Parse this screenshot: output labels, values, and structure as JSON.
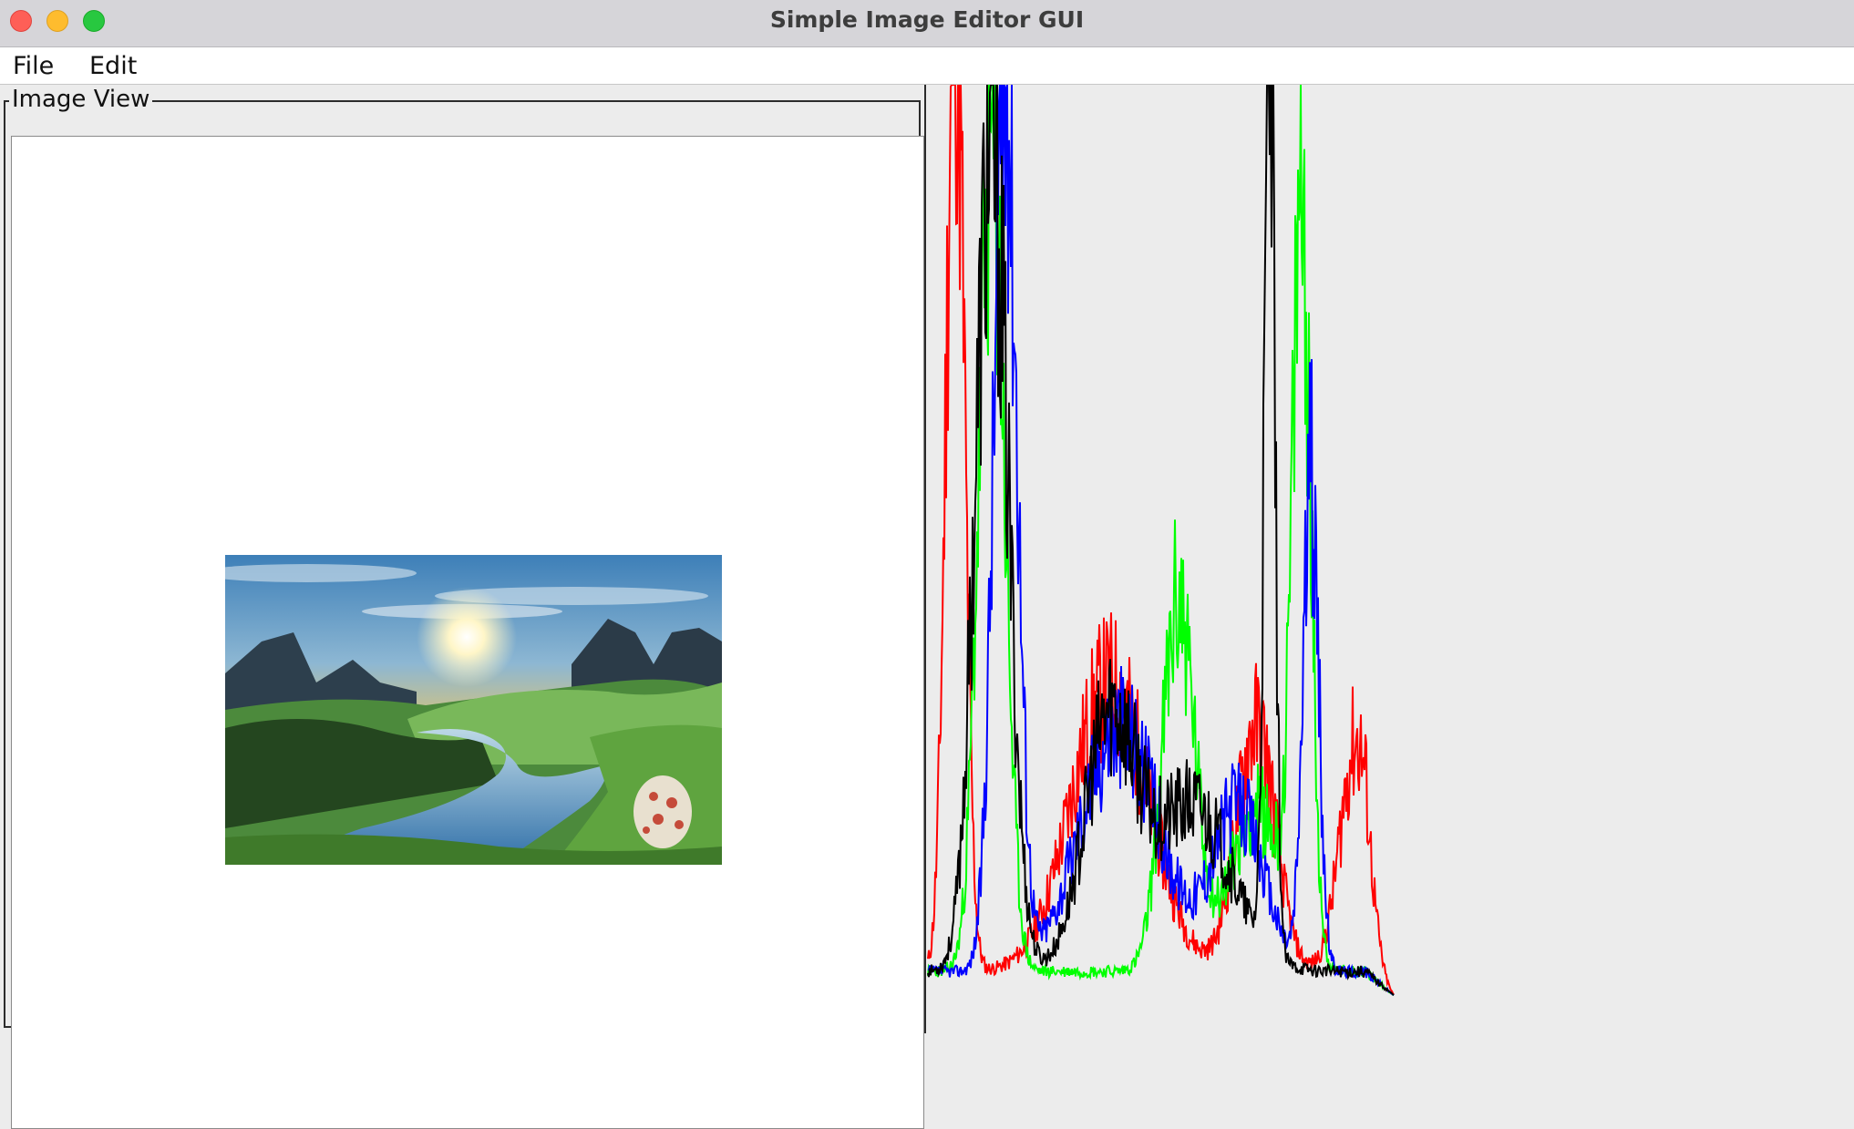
{
  "window": {
    "title": "Simple Image Editor GUI"
  },
  "menubar": {
    "items": [
      "File",
      "Edit"
    ]
  },
  "image_panel": {
    "label": "Image View"
  },
  "histogram": {
    "colors": {
      "red": "#ff0000",
      "green": "#00ff00",
      "blue": "#0000ff",
      "luminance": "#000000"
    }
  }
}
